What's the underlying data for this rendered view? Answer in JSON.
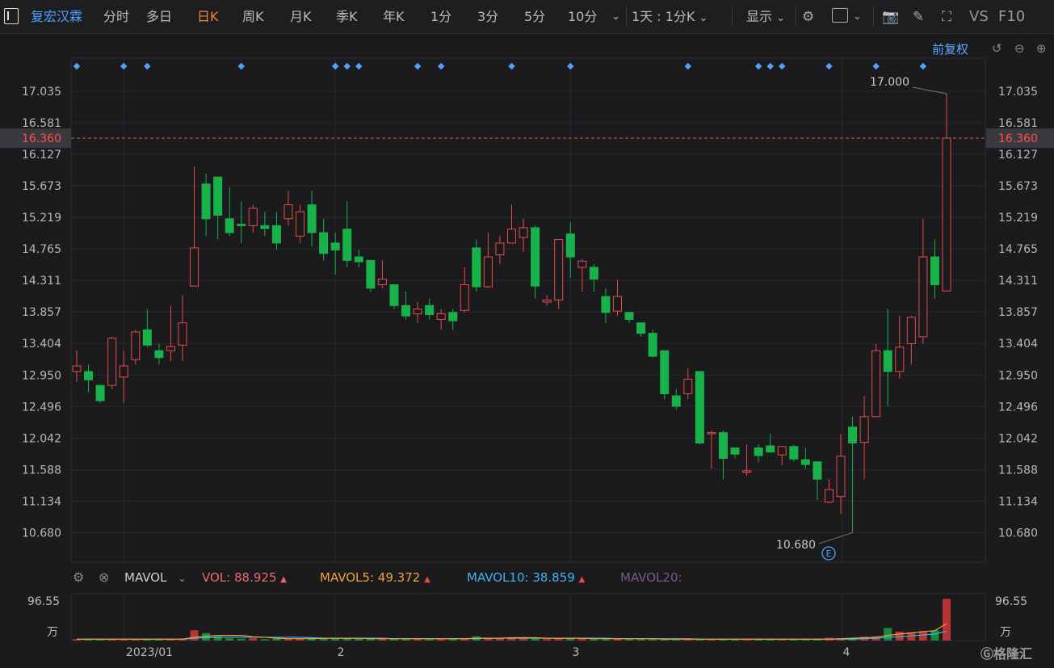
{
  "toolbar": {
    "stock_name": "复宏汉霖",
    "periods": [
      "分时",
      "多日",
      "日K",
      "周K",
      "月K",
      "季K",
      "年K",
      "1分",
      "3分",
      "5分",
      "10分"
    ],
    "active_period": "日K",
    "interval_select": "1天 : 1分K",
    "display_select": "显示",
    "vs_label": "VS",
    "f10_label": "F10"
  },
  "adjust_mode": "前复权",
  "price_axis": {
    "ticks": [
      "17.035",
      "16.581",
      "16.127",
      "15.673",
      "15.219",
      "14.765",
      "14.311",
      "13.857",
      "13.404",
      "12.950",
      "12.496",
      "12.042",
      "11.588",
      "11.134",
      "10.680"
    ],
    "current_price": "16.360",
    "high_label": "17.000",
    "low_label": "10.680",
    "event_badge": "E"
  },
  "volume_legend": {
    "indicator": "MAVOL",
    "vol_label": "VOL:",
    "vol_value": "88.925",
    "mavol5_label": "MAVOL5:",
    "mavol5_value": "49.372",
    "mavol10_label": "MAVOL10:",
    "mavol10_value": "38.859",
    "mavol20_label": "MAVOL20:"
  },
  "volume_axis": {
    "top": "96.55",
    "unit": "万"
  },
  "x_axis": {
    "labels": [
      "2023/01",
      "2",
      "3",
      "4"
    ]
  },
  "watermark": "格隆汇",
  "colors": {
    "up": "#e84a4a",
    "down": "#18b24a",
    "accent": "#f0843b",
    "link": "#4ea1ff"
  },
  "chart_data": {
    "type": "candlestick",
    "ylim": [
      10.68,
      17.035
    ],
    "candles": [
      {
        "o": 13.0,
        "h": 13.3,
        "l": 12.85,
        "c": 13.08
      },
      {
        "o": 13.0,
        "h": 13.1,
        "l": 12.7,
        "c": 12.88
      },
      {
        "o": 12.8,
        "h": 12.8,
        "l": 12.55,
        "c": 12.58
      },
      {
        "o": 12.8,
        "h": 13.5,
        "l": 12.75,
        "c": 13.48
      },
      {
        "o": 12.92,
        "h": 13.3,
        "l": 12.55,
        "c": 13.08
      },
      {
        "o": 13.17,
        "h": 13.6,
        "l": 13.1,
        "c": 13.57
      },
      {
        "o": 13.6,
        "h": 13.9,
        "l": 13.35,
        "c": 13.38
      },
      {
        "o": 13.3,
        "h": 13.4,
        "l": 13.1,
        "c": 13.2
      },
      {
        "o": 13.3,
        "h": 13.95,
        "l": 13.15,
        "c": 13.36
      },
      {
        "o": 13.38,
        "h": 14.1,
        "l": 13.15,
        "c": 13.7
      },
      {
        "o": 14.23,
        "h": 15.95,
        "l": 14.23,
        "c": 14.78
      },
      {
        "o": 15.7,
        "h": 15.85,
        "l": 14.95,
        "c": 15.2
      },
      {
        "o": 15.8,
        "h": 15.8,
        "l": 14.9,
        "c": 15.25
      },
      {
        "o": 15.2,
        "h": 15.65,
        "l": 14.95,
        "c": 15.0
      },
      {
        "o": 15.12,
        "h": 15.45,
        "l": 14.85,
        "c": 15.1
      },
      {
        "o": 15.1,
        "h": 15.4,
        "l": 15.0,
        "c": 15.35
      },
      {
        "o": 15.1,
        "h": 15.3,
        "l": 14.95,
        "c": 15.06
      },
      {
        "o": 15.1,
        "h": 15.3,
        "l": 14.75,
        "c": 14.85
      },
      {
        "o": 15.2,
        "h": 15.6,
        "l": 15.1,
        "c": 15.4
      },
      {
        "o": 14.95,
        "h": 15.4,
        "l": 14.85,
        "c": 15.3
      },
      {
        "o": 15.4,
        "h": 15.6,
        "l": 14.8,
        "c": 15.0
      },
      {
        "o": 15.0,
        "h": 15.2,
        "l": 14.6,
        "c": 14.7
      },
      {
        "o": 14.85,
        "h": 15.0,
        "l": 14.4,
        "c": 14.75
      },
      {
        "o": 15.05,
        "h": 15.45,
        "l": 14.5,
        "c": 14.6
      },
      {
        "o": 14.65,
        "h": 14.75,
        "l": 14.5,
        "c": 14.58
      },
      {
        "o": 14.6,
        "h": 14.6,
        "l": 14.15,
        "c": 14.2
      },
      {
        "o": 14.25,
        "h": 14.6,
        "l": 14.2,
        "c": 14.33
      },
      {
        "o": 14.25,
        "h": 14.25,
        "l": 13.9,
        "c": 13.95
      },
      {
        "o": 13.95,
        "h": 14.15,
        "l": 13.75,
        "c": 13.8
      },
      {
        "o": 13.83,
        "h": 14.0,
        "l": 13.7,
        "c": 13.9
      },
      {
        "o": 13.95,
        "h": 14.05,
        "l": 13.75,
        "c": 13.82
      },
      {
        "o": 13.75,
        "h": 13.9,
        "l": 13.6,
        "c": 13.83
      },
      {
        "o": 13.85,
        "h": 13.9,
        "l": 13.6,
        "c": 13.73
      },
      {
        "o": 13.88,
        "h": 14.5,
        "l": 13.85,
        "c": 14.25
      },
      {
        "o": 14.78,
        "h": 14.9,
        "l": 14.15,
        "c": 14.22
      },
      {
        "o": 14.22,
        "h": 15.0,
        "l": 14.2,
        "c": 14.65
      },
      {
        "o": 14.68,
        "h": 14.95,
        "l": 14.55,
        "c": 14.85
      },
      {
        "o": 14.85,
        "h": 15.4,
        "l": 14.85,
        "c": 15.05
      },
      {
        "o": 14.93,
        "h": 15.2,
        "l": 14.72,
        "c": 15.07
      },
      {
        "o": 15.07,
        "h": 15.1,
        "l": 14.05,
        "c": 14.23
      },
      {
        "o": 14.0,
        "h": 14.1,
        "l": 13.95,
        "c": 14.03
      },
      {
        "o": 14.03,
        "h": 14.9,
        "l": 13.9,
        "c": 14.9
      },
      {
        "o": 14.98,
        "h": 15.15,
        "l": 14.35,
        "c": 14.65
      },
      {
        "o": 14.5,
        "h": 14.62,
        "l": 14.15,
        "c": 14.59
      },
      {
        "o": 14.5,
        "h": 14.55,
        "l": 14.15,
        "c": 14.33
      },
      {
        "o": 14.08,
        "h": 14.2,
        "l": 13.7,
        "c": 13.85
      },
      {
        "o": 13.87,
        "h": 14.32,
        "l": 13.8,
        "c": 14.08
      },
      {
        "o": 13.85,
        "h": 13.85,
        "l": 13.7,
        "c": 13.75
      },
      {
        "o": 13.7,
        "h": 13.7,
        "l": 13.5,
        "c": 13.55
      },
      {
        "o": 13.55,
        "h": 13.6,
        "l": 13.2,
        "c": 13.22
      },
      {
        "o": 13.3,
        "h": 13.3,
        "l": 12.6,
        "c": 12.68
      },
      {
        "o": 12.65,
        "h": 12.75,
        "l": 12.45,
        "c": 12.5
      },
      {
        "o": 12.68,
        "h": 13.05,
        "l": 12.6,
        "c": 12.89
      },
      {
        "o": 13.0,
        "h": 13.0,
        "l": 11.95,
        "c": 11.97
      },
      {
        "o": 12.12,
        "h": 12.15,
        "l": 11.6,
        "c": 12.12
      },
      {
        "o": 12.12,
        "h": 12.15,
        "l": 11.45,
        "c": 11.75
      },
      {
        "o": 11.9,
        "h": 11.9,
        "l": 11.75,
        "c": 11.81
      },
      {
        "o": 11.55,
        "h": 11.95,
        "l": 11.5,
        "c": 11.57
      },
      {
        "o": 11.9,
        "h": 11.95,
        "l": 11.7,
        "c": 11.79
      },
      {
        "o": 11.93,
        "h": 12.1,
        "l": 11.85,
        "c": 11.84
      },
      {
        "o": 11.8,
        "h": 11.93,
        "l": 11.65,
        "c": 11.92
      },
      {
        "o": 11.92,
        "h": 11.95,
        "l": 11.7,
        "c": 11.74
      },
      {
        "o": 11.73,
        "h": 11.9,
        "l": 11.6,
        "c": 11.66
      },
      {
        "o": 11.7,
        "h": 11.7,
        "l": 11.15,
        "c": 11.45
      },
      {
        "o": 11.12,
        "h": 11.45,
        "l": 11.1,
        "c": 11.3
      },
      {
        "o": 11.2,
        "h": 12.1,
        "l": 10.95,
        "c": 11.78
      },
      {
        "o": 12.2,
        "h": 12.35,
        "l": 10.68,
        "c": 11.97
      },
      {
        "o": 11.98,
        "h": 12.65,
        "l": 11.45,
        "c": 12.35
      },
      {
        "o": 12.35,
        "h": 13.4,
        "l": 12.35,
        "c": 13.3
      },
      {
        "o": 13.3,
        "h": 13.9,
        "l": 12.5,
        "c": 13.0
      },
      {
        "o": 13.0,
        "h": 13.8,
        "l": 12.9,
        "c": 13.35
      },
      {
        "o": 13.4,
        "h": 13.8,
        "l": 13.1,
        "c": 13.78
      },
      {
        "o": 13.5,
        "h": 15.2,
        "l": 13.4,
        "c": 14.65
      },
      {
        "o": 14.65,
        "h": 14.9,
        "l": 14.05,
        "c": 14.25
      },
      {
        "o": 14.16,
        "h": 17.0,
        "l": 14.16,
        "c": 16.36
      }
    ],
    "volumes": [
      3,
      4,
      2,
      3,
      2,
      3,
      4,
      2,
      3,
      4,
      22,
      16,
      9,
      5,
      4,
      5,
      3,
      4,
      4,
      5,
      6,
      5,
      4,
      5,
      4,
      4,
      5,
      4,
      3,
      4,
      3,
      4,
      3,
      4,
      9,
      5,
      4,
      6,
      7,
      4,
      3,
      4,
      5,
      4,
      3,
      3,
      4,
      3,
      3,
      3,
      4,
      3,
      4,
      3,
      3,
      4,
      3,
      2,
      3,
      3,
      3,
      3,
      3,
      4,
      6,
      5,
      6,
      8,
      9,
      27,
      19,
      18,
      20,
      22,
      89
    ],
    "mavol5_line": [
      3,
      3,
      3,
      3,
      3,
      3,
      3,
      3,
      3,
      3,
      7,
      9,
      11,
      11,
      11,
      8,
      7,
      5,
      4,
      4,
      4,
      5,
      5,
      5,
      5,
      4,
      4,
      4,
      4,
      4,
      4,
      4,
      4,
      4,
      5,
      5,
      5,
      6,
      6,
      6,
      5,
      5,
      5,
      5,
      4,
      4,
      4,
      4,
      4,
      4,
      3,
      3,
      3,
      3,
      3,
      3,
      3,
      3,
      3,
      3,
      3,
      3,
      3,
      3,
      3,
      4,
      5,
      6,
      7,
      11,
      14,
      16,
      19,
      21,
      36
    ],
    "mavol10_line": [
      3,
      3,
      3,
      3,
      3,
      3,
      3,
      3,
      3,
      3,
      5,
      6,
      7,
      7,
      7,
      7,
      7,
      7,
      7,
      7,
      6,
      5,
      5,
      5,
      5,
      5,
      5,
      4,
      4,
      4,
      4,
      4,
      4,
      4,
      4,
      5,
      5,
      5,
      5,
      5,
      5,
      5,
      5,
      5,
      5,
      5,
      4,
      4,
      4,
      4,
      4,
      4,
      4,
      3,
      3,
      3,
      3,
      3,
      3,
      3,
      3,
      3,
      3,
      3,
      3,
      3,
      3,
      4,
      5,
      7,
      8,
      10,
      12,
      14,
      20
    ],
    "event_diamond_indices": [
      0,
      4,
      6,
      14,
      22,
      23,
      24,
      29,
      31,
      37,
      42,
      52,
      58,
      59,
      60,
      64,
      68,
      72
    ]
  }
}
